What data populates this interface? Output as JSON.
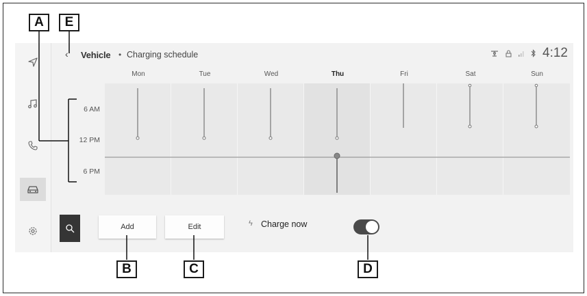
{
  "header": {
    "back_glyph": "‹",
    "title": "Vehicle",
    "separator": "•",
    "subtitle": "Charging schedule",
    "clock": "4:12"
  },
  "days": [
    {
      "label": "Mon",
      "today": false,
      "start": "5 AM",
      "end": "12 PM",
      "marker_end": true
    },
    {
      "label": "Tue",
      "today": false,
      "start": "5 AM",
      "end": "12 PM",
      "marker_end": true
    },
    {
      "label": "Wed",
      "today": false,
      "start": "5 AM",
      "end": "12 PM",
      "marker_end": true
    },
    {
      "label": "Thu",
      "today": true,
      "start": "5 AM",
      "end": "12 PM",
      "marker_end": true
    },
    {
      "label": "Fri",
      "today": false,
      "start": "12 AM",
      "end": "9 AM",
      "marker_end": false
    },
    {
      "label": "Sat",
      "today": false,
      "start": "12 AM",
      "end": "9 AM",
      "marker_end": true
    },
    {
      "label": "Sun",
      "today": false,
      "start": "12 AM",
      "end": "9 AM",
      "marker_end": true
    }
  ],
  "time_axis": {
    "labels": [
      "6 AM",
      "12 PM",
      "6 PM"
    ]
  },
  "current_time_indicator": {
    "day": "Thu",
    "time": "4:12 PM"
  },
  "buttons": {
    "add": "Add",
    "edit": "Edit"
  },
  "charge_now": {
    "label": "Charge now",
    "icon": "bolt-icon",
    "enabled": true
  },
  "sidebar": {
    "items": [
      {
        "icon": "navigation-icon",
        "active": false
      },
      {
        "icon": "music-icon",
        "active": false
      },
      {
        "icon": "phone-icon",
        "active": false
      },
      {
        "icon": "car-icon",
        "active": true
      },
      {
        "icon": "settings-icon",
        "active": false
      }
    ]
  },
  "status_icons": [
    "antenna-icon",
    "lock-icon",
    "signal-icon",
    "bluetooth-icon"
  ],
  "callouts": {
    "A": "A",
    "B": "B",
    "C": "C",
    "D": "D",
    "E": "E"
  },
  "colors": {
    "toggle_on": "#4a4a4a",
    "search_button": "#353535",
    "screen_bg": "#f2f2f2"
  }
}
